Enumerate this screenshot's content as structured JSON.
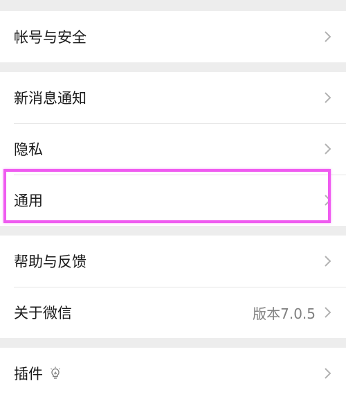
{
  "settings": {
    "groups": [
      {
        "items": [
          {
            "label": "帐号与安全"
          }
        ]
      },
      {
        "items": [
          {
            "label": "新消息通知"
          },
          {
            "label": "隐私"
          },
          {
            "label": "通用"
          }
        ]
      },
      {
        "items": [
          {
            "label": "帮助与反馈"
          },
          {
            "label": "关于微信",
            "value": "版本7.0.5"
          }
        ]
      },
      {
        "items": [
          {
            "label": "插件",
            "icon": "lightbulb-icon"
          }
        ]
      }
    ]
  },
  "colors": {
    "background": "#ededed",
    "row_background": "#ffffff",
    "highlight": "#ef5bf0",
    "secondary_text": "#7f7f7f",
    "chevron": "#b2b2b2"
  }
}
